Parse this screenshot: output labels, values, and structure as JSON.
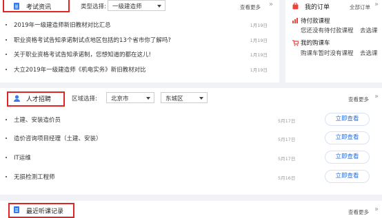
{
  "news": {
    "title": "考试资讯",
    "type_label": "类型选择:",
    "type_value": "一级建造师",
    "more": "查看更多",
    "more_arrow": "»",
    "items": [
      {
        "text": "2019年一级建造师新旧教材对比汇总",
        "date": "1月19日"
      },
      {
        "text": "职业资格考试告知承诺制试点地区包括的13个省市你了解吗?",
        "date": "1月19日"
      },
      {
        "text": "关于职业资格考试告知承诺制，您想知道的都在这儿!",
        "date": "1月19日"
      },
      {
        "text": "大立2019年一级建造师《机电实务》新旧教材对比",
        "date": "1月19日"
      }
    ]
  },
  "orders": {
    "title": "我的订单",
    "all_link": "全部订单",
    "more_arrow": "»",
    "items": [
      {
        "title": "待付款课程",
        "sub": "您还没有待付款课程",
        "action": "去选课"
      },
      {
        "title": "我的购课车",
        "sub": "购课车暂时没有课程",
        "action": "去选课"
      }
    ]
  },
  "jobs": {
    "title": "人才招聘",
    "region_label": "区域选择:",
    "city": "北京市",
    "district": "东城区",
    "more": "查看更多",
    "more_arrow": "»",
    "items": [
      {
        "text": "土建、安装造价员",
        "date": "5月17日",
        "action": "立即查看"
      },
      {
        "text": "造价咨询项目经理（土建、安装）",
        "date": "5月17日",
        "action": "立即查看"
      },
      {
        "text": "IT运维",
        "date": "5月17日",
        "action": "立即查看"
      },
      {
        "text": "无损检测工程师",
        "date": "5月16日",
        "action": "立即查看"
      }
    ]
  },
  "recent": {
    "title": "最近听课记录",
    "more": "查看更多",
    "more_arrow": "»"
  },
  "colors": {
    "accent": "#3a7be8",
    "highlight_box": "#e02424",
    "order_icon": "#e8453c"
  }
}
